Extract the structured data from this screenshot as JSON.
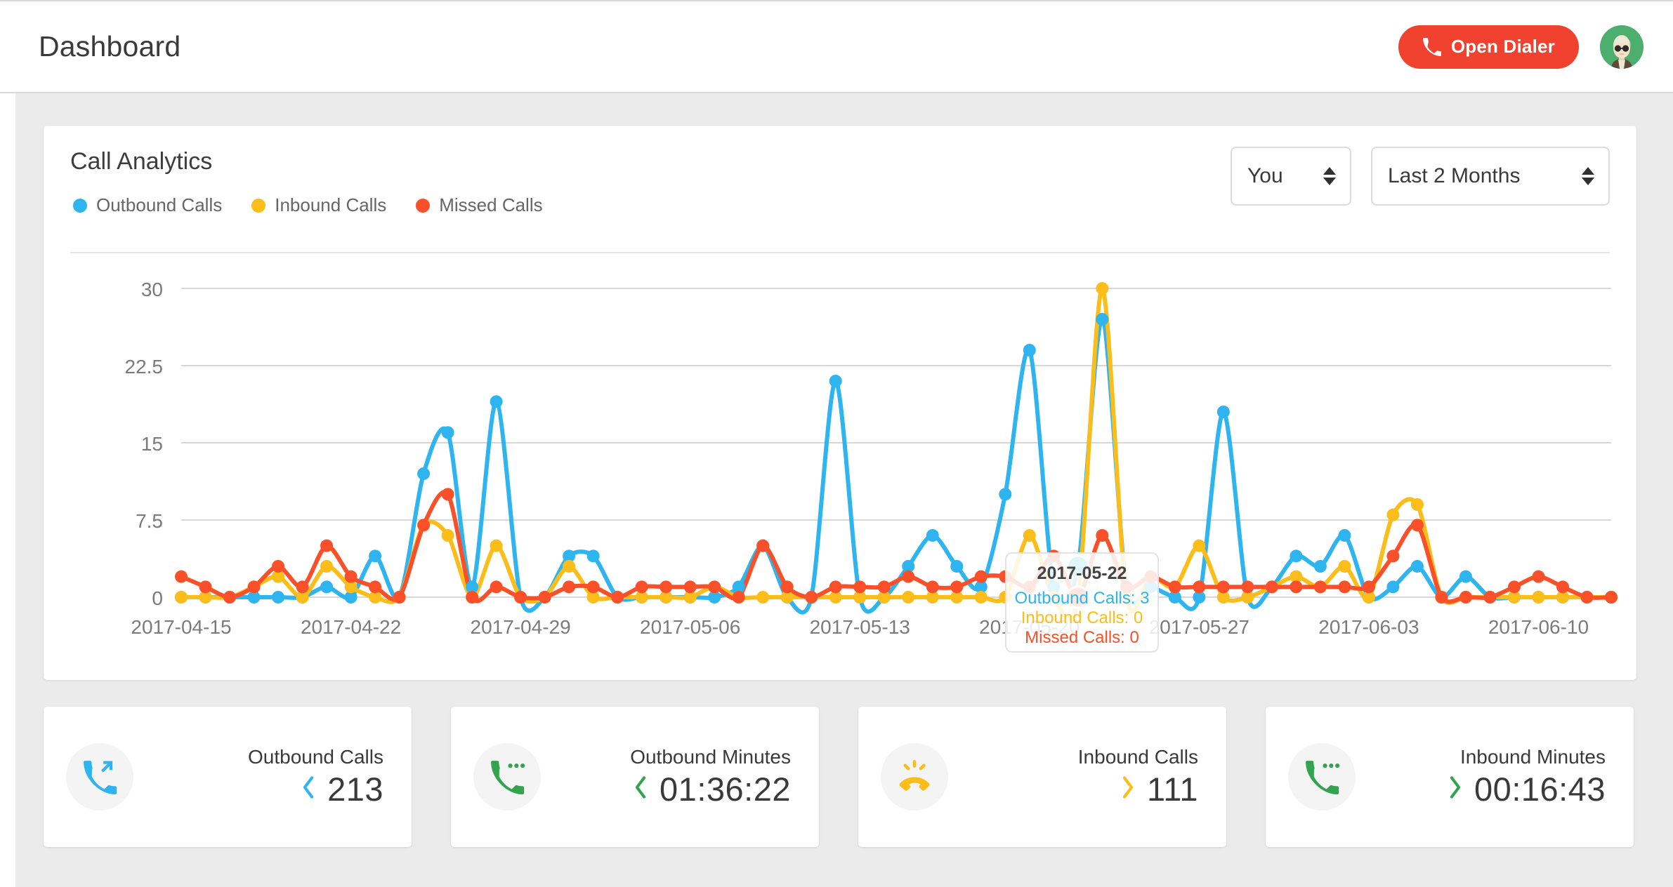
{
  "header": {
    "title": "Dashboard",
    "dialer_button_label": "Open Dialer",
    "dialer_icon": "phone-icon",
    "avatar_name": "user-avatar"
  },
  "analytics_card": {
    "title": "Call Analytics",
    "legend": [
      {
        "label": "Outbound Calls",
        "color": "#2eb4ef"
      },
      {
        "label": "Inbound Calls",
        "color": "#fbbd19"
      },
      {
        "label": "Missed Calls",
        "color": "#f9502a"
      }
    ],
    "user_select": {
      "value": "You"
    },
    "range_select": {
      "value": "Last 2 Months"
    },
    "tooltip": {
      "date": "2017-05-22",
      "rows": [
        {
          "label": "Outbound Calls: 3",
          "color": "#2eb4ef"
        },
        {
          "label": "Inbound Calls: 0",
          "color": "#fbbd19"
        },
        {
          "label": "Missed Calls: 0",
          "color": "#f9502a"
        }
      ]
    }
  },
  "chart_data": {
    "type": "line",
    "title": "Call Analytics",
    "xlabel": "",
    "ylabel": "",
    "ylim": [
      0,
      30
    ],
    "yticks": [
      0,
      7.5,
      15,
      22.5,
      30
    ],
    "ytick_labels": [
      "0",
      "7.5",
      "15",
      "22.5",
      "30"
    ],
    "grid": true,
    "legend_position": "top-left",
    "xtick_labels": [
      "2017-04-15",
      "2017-04-22",
      "2017-04-29",
      "2017-05-06",
      "2017-05-13",
      "2017-05-20",
      "2017-05-27",
      "2017-06-03",
      "2017-06-10"
    ],
    "x": [
      "2017-04-15",
      "2017-04-16",
      "2017-04-17",
      "2017-04-18",
      "2017-04-19",
      "2017-04-20",
      "2017-04-21",
      "2017-04-22",
      "2017-04-23",
      "2017-04-24",
      "2017-04-25",
      "2017-04-26",
      "2017-04-27",
      "2017-04-28",
      "2017-04-29",
      "2017-04-30",
      "2017-05-01",
      "2017-05-02",
      "2017-05-03",
      "2017-05-04",
      "2017-05-05",
      "2017-05-06",
      "2017-05-07",
      "2017-05-08",
      "2017-05-09",
      "2017-05-10",
      "2017-05-11",
      "2017-05-12",
      "2017-05-13",
      "2017-05-14",
      "2017-05-15",
      "2017-05-16",
      "2017-05-17",
      "2017-05-18",
      "2017-05-19",
      "2017-05-20",
      "2017-05-21",
      "2017-05-22",
      "2017-05-23",
      "2017-05-24",
      "2017-05-25",
      "2017-05-26",
      "2017-05-27",
      "2017-05-28",
      "2017-05-29",
      "2017-05-30",
      "2017-05-31",
      "2017-06-01",
      "2017-06-02",
      "2017-06-03",
      "2017-06-04",
      "2017-06-05",
      "2017-06-06",
      "2017-06-07",
      "2017-06-08",
      "2017-06-09",
      "2017-06-10",
      "2017-06-11",
      "2017-06-12",
      "2017-06-13"
    ],
    "series": [
      {
        "name": "Outbound Calls",
        "color": "#2eb4ef",
        "values": [
          0,
          0,
          0,
          0,
          0,
          0,
          1,
          0,
          4,
          0,
          12,
          16,
          1,
          19,
          0,
          0,
          4,
          4,
          0,
          0,
          0,
          0,
          0,
          1,
          5,
          0,
          0,
          21,
          0,
          0,
          3,
          6,
          3,
          1,
          10,
          24,
          1,
          3,
          27,
          1,
          1,
          0,
          0,
          18,
          0,
          1,
          4,
          3,
          6,
          0,
          1,
          3,
          0,
          2,
          0,
          0,
          0,
          0,
          0,
          0
        ]
      },
      {
        "name": "Inbound Calls",
        "color": "#fbbd19",
        "values": [
          0,
          0,
          0,
          1,
          2,
          0,
          3,
          1,
          0,
          0,
          7,
          6,
          0,
          5,
          0,
          0,
          3,
          0,
          0,
          0,
          0,
          0,
          1,
          0,
          0,
          0,
          0,
          0,
          0,
          0,
          0,
          0,
          0,
          0,
          0,
          6,
          0,
          0,
          30,
          0,
          2,
          1,
          5,
          0,
          0,
          1,
          2,
          1,
          3,
          0,
          8,
          9,
          0,
          0,
          0,
          0,
          0,
          0,
          0,
          0
        ]
      },
      {
        "name": "Missed Calls",
        "color": "#f9502a",
        "values": [
          2,
          1,
          0,
          1,
          3,
          1,
          5,
          2,
          1,
          0,
          7,
          10,
          0,
          1,
          0,
          0,
          1,
          1,
          0,
          1,
          1,
          1,
          1,
          0,
          5,
          1,
          0,
          1,
          1,
          1,
          2,
          1,
          1,
          2,
          2,
          1,
          4,
          0,
          6,
          1,
          2,
          1,
          1,
          1,
          1,
          1,
          1,
          1,
          1,
          1,
          4,
          7,
          0,
          0,
          0,
          1,
          2,
          1,
          0,
          0
        ]
      }
    ],
    "hover": {
      "date": "2017-05-22",
      "outbound": 3,
      "inbound": 0,
      "missed": 0
    }
  },
  "stats": [
    {
      "label": "Outbound Calls",
      "value": "213",
      "icon": "phone-outgoing-icon",
      "icon_color": "#2eb4ef",
      "chevron": "chevron-left-icon",
      "chevron_color": "#2eb4ef"
    },
    {
      "label": "Outbound Minutes",
      "value": "01:36:22",
      "icon": "phone-talk-icon",
      "icon_color": "#34a350",
      "chevron": "chevron-left-icon",
      "chevron_color": "#34a350"
    },
    {
      "label": "Inbound Calls",
      "value": "111",
      "icon": "phone-ringing-icon",
      "icon_color": "#fbbd19",
      "chevron": "chevron-right-icon",
      "chevron_color": "#fbbd19"
    },
    {
      "label": "Inbound Minutes",
      "value": "00:16:43",
      "icon": "phone-talk-icon",
      "icon_color": "#34a350",
      "chevron": "chevron-right-icon",
      "chevron_color": "#34a350"
    }
  ]
}
